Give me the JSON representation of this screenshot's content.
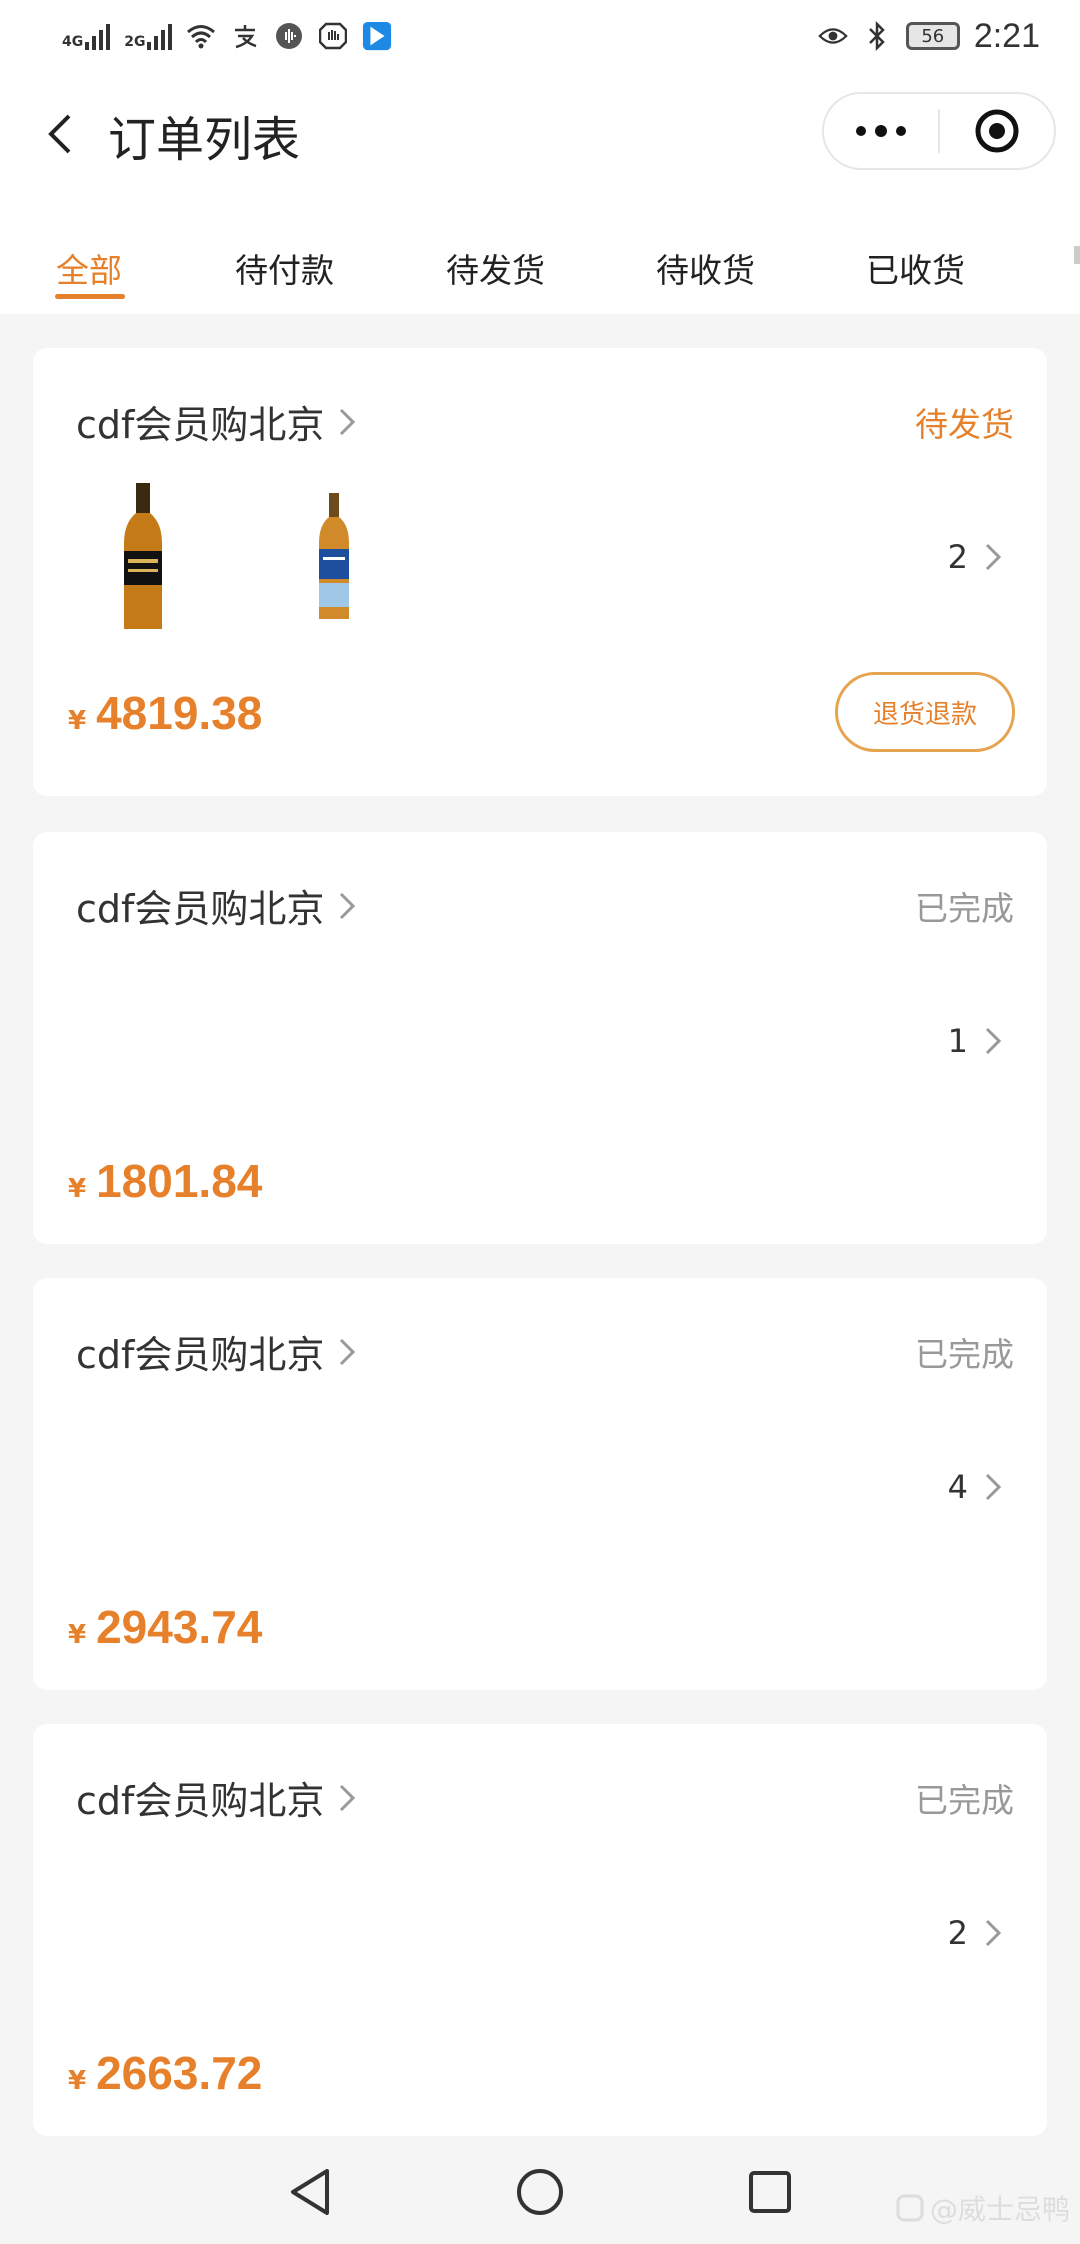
{
  "status_bar": {
    "network1": "4G",
    "network2": "2G",
    "battery": "56",
    "time": "2:21"
  },
  "header": {
    "title": "订单列表"
  },
  "tabs": [
    {
      "label": "全部",
      "active": true
    },
    {
      "label": "待付款",
      "active": false
    },
    {
      "label": "待发货",
      "active": false
    },
    {
      "label": "待收货",
      "active": false
    },
    {
      "label": "已收货",
      "active": false
    }
  ],
  "orders": [
    {
      "store": "cdf会员购北京",
      "status": "待发货",
      "count": "2",
      "currency": "¥",
      "price": "4819.38",
      "action": "退货退款"
    },
    {
      "store": "cdf会员购北京",
      "status": "已完成",
      "count": "1",
      "currency": "¥",
      "price": "1801.84"
    },
    {
      "store": "cdf会员购北京",
      "status": "已完成",
      "count": "4",
      "currency": "¥",
      "price": "2943.74"
    },
    {
      "store": "cdf会员购北京",
      "status": "已完成",
      "count": "2",
      "currency": "¥",
      "price": "2663.72"
    }
  ],
  "watermark": "@威士忌鸭",
  "colors": {
    "accent": "#e6802a",
    "muted": "#999999",
    "background": "#f5f5f5"
  }
}
